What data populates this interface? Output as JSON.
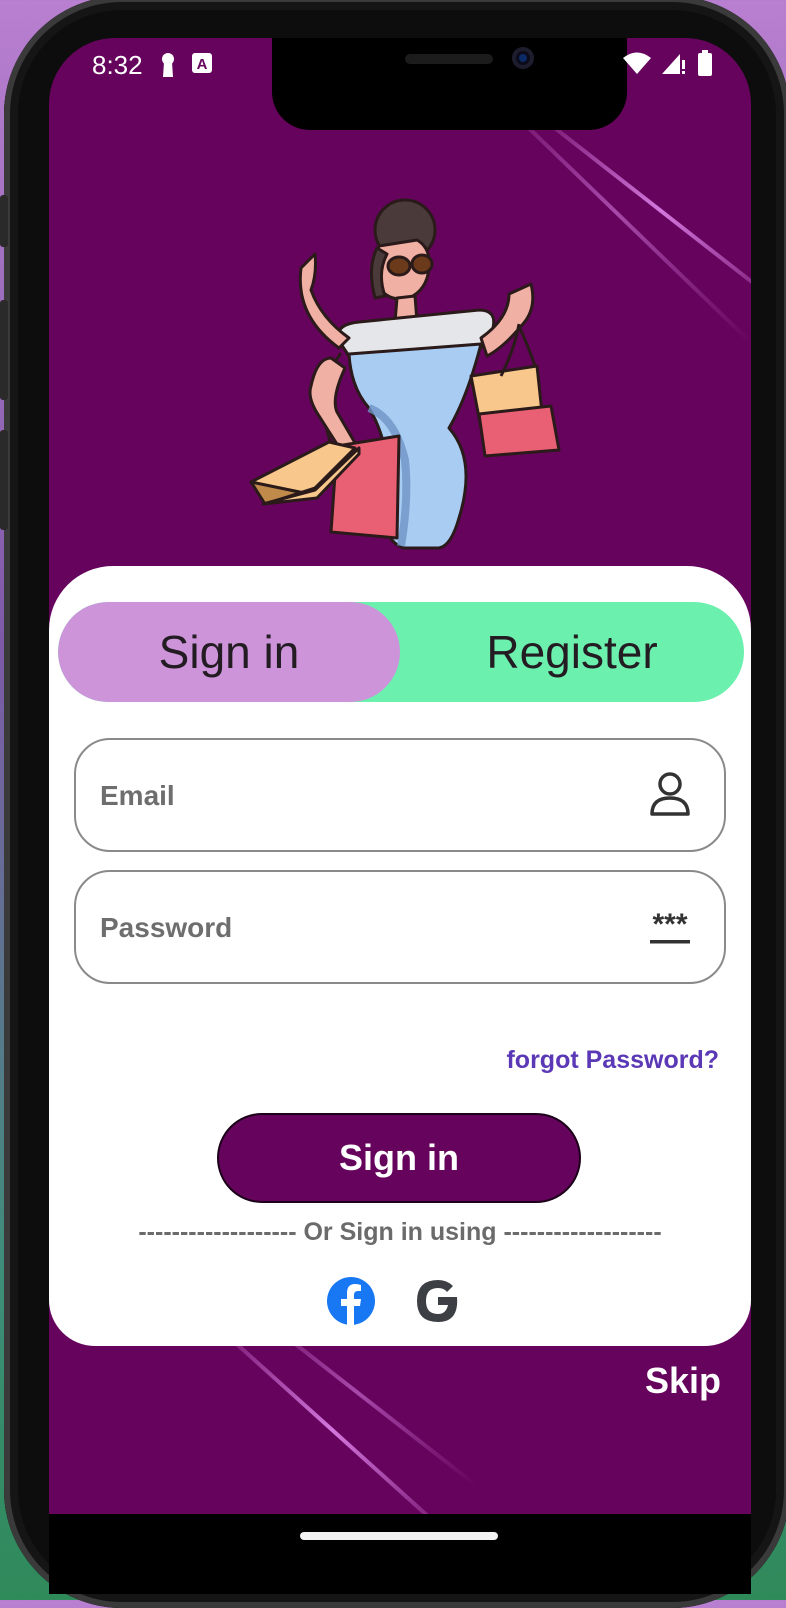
{
  "status_bar": {
    "time": "8:32"
  },
  "auth_toggle": {
    "signin_label": "Sign in",
    "register_label": "Register"
  },
  "form": {
    "email_placeholder": "Email",
    "password_placeholder": "Password",
    "forgot_label": "forgot Password?",
    "signin_button": "Sign in",
    "divider_text": "------------------- Or Sign in using -------------------"
  },
  "social": [
    "facebook-icon",
    "google-icon"
  ],
  "skip_label": "Skip",
  "colors": {
    "background": "#66035c",
    "signin_tab": "#cd94da",
    "register_tab": "#6cf0ad",
    "link": "#5b38b5",
    "facebook": "#1877f2",
    "google": "#3c3f44"
  }
}
